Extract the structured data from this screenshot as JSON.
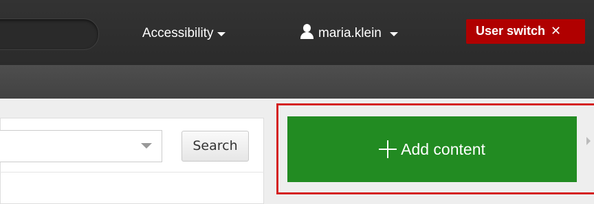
{
  "header": {
    "accessibility_label": "Accessibility",
    "username": "maria.klein",
    "user_switch_label": "User switch",
    "user_switch_close": "✕"
  },
  "search": {
    "select_value": "",
    "button_label": "Search"
  },
  "actions": {
    "add_content_label": "Add content"
  },
  "colors": {
    "topbar": "#2f2f2f",
    "user_switch": "#b00000",
    "add_content": "#228b22",
    "highlight": "#d42020"
  },
  "icons": {
    "user": "user-icon",
    "plus": "plus-icon",
    "caret": "chevron-down-icon",
    "close": "close-icon"
  }
}
